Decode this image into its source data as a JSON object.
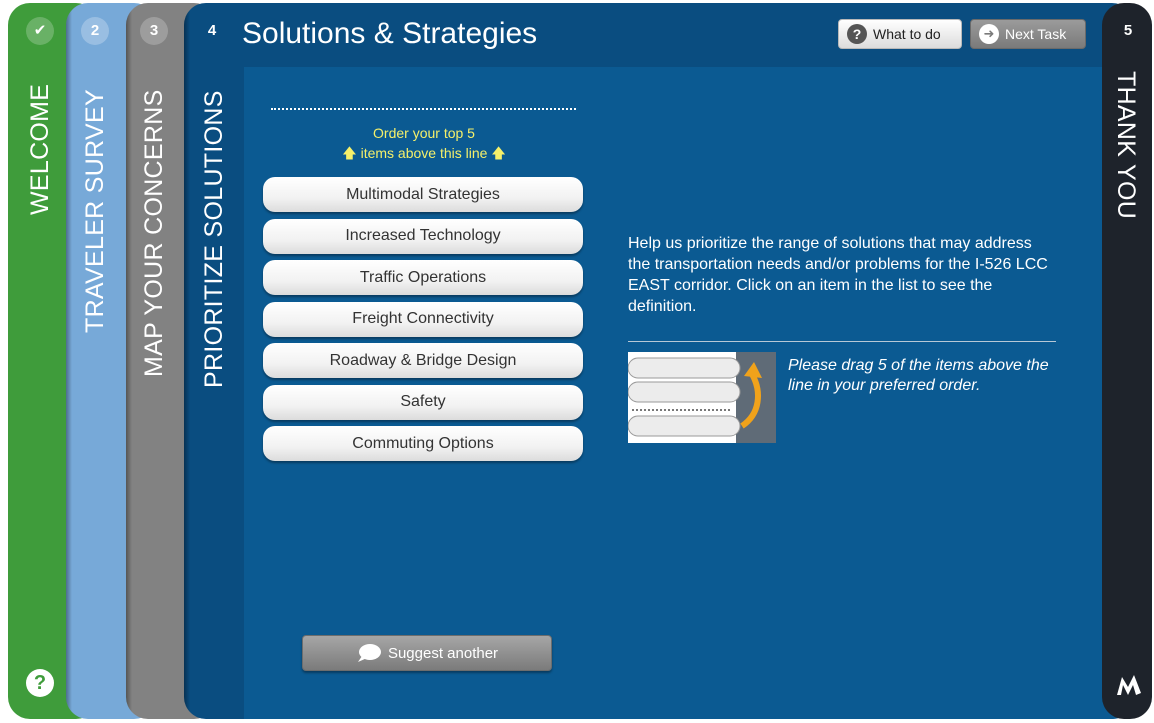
{
  "tabs": [
    {
      "badge": "✔",
      "label": "WELCOME"
    },
    {
      "badge": "2",
      "label": "TRAVELER SURVEY"
    },
    {
      "badge": "3",
      "label": "MAP YOUR CONCERNS"
    },
    {
      "badge": "4",
      "label": "PRIORITIZE SOLUTIONS"
    },
    {
      "badge": "5",
      "label": "THANK YOU"
    }
  ],
  "help_icon": "question-icon",
  "main": {
    "title": "Solutions & Strategies",
    "what_to_do": "What to do",
    "next_task": "Next Task",
    "order_line1": "Order your top 5",
    "order_line2": "items above this line",
    "solutions": [
      "Multimodal Strategies",
      "Increased Technology",
      "Traffic Operations",
      "Freight Connectivity",
      "Roadway & Bridge Design",
      "Safety",
      "Commuting Options"
    ],
    "help_text": "Help us prioritize the range of solutions that may address the transportation needs and/or problems for the I-526 LCC EAST corridor. Click on an item in the list to see the definition.",
    "drag_text": "Please drag 5 of the items above the line in your preferred order.",
    "suggest_label": "Suggest another"
  },
  "colors": {
    "welcome": "#3f9c3b",
    "survey": "#77a9d8",
    "concerns": "#828282",
    "prioritize": "#0a4d80",
    "thankyou": "#1e232b",
    "highlight_text": "#f5f06a"
  }
}
